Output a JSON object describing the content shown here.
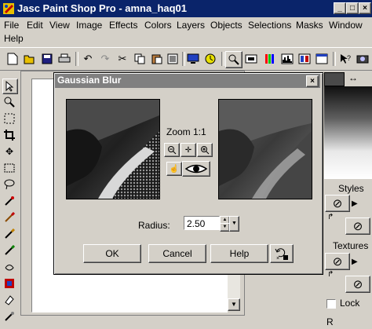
{
  "window": {
    "title": "Jasc Paint Shop Pro - amna_haq01"
  },
  "menu": [
    "File",
    "Edit",
    "View",
    "Image",
    "Effects",
    "Colors",
    "Layers",
    "Objects",
    "Selections",
    "Masks",
    "Window",
    "Help"
  ],
  "dialog": {
    "title": "Gaussian Blur",
    "zoom_label": "Zoom 1:1",
    "radius_label": "Radius:",
    "radius_value": "2.50",
    "ok_label": "OK",
    "cancel_label": "Cancel",
    "help_label": "Help"
  },
  "right_panel": {
    "styles_label": "Styles",
    "textures_label": "Textures",
    "lock_label": "Lock",
    "footer_label": "R"
  },
  "colors": {
    "titlebar": "#0a246a",
    "dialog_titlebar": "#808080",
    "face": "#d4d0c8"
  }
}
